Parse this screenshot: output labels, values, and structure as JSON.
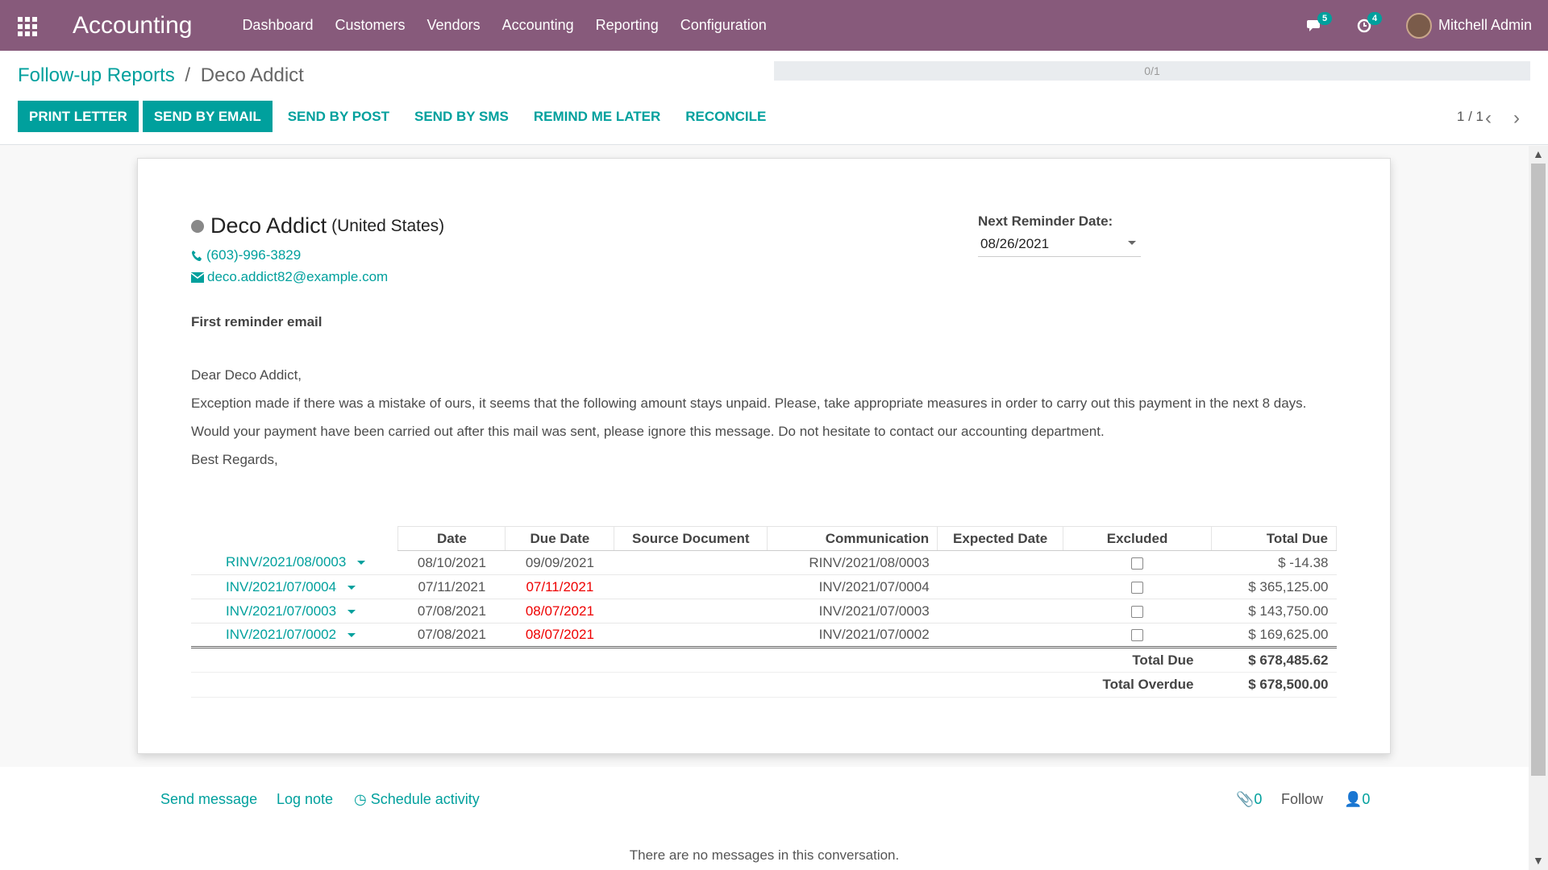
{
  "navbar": {
    "brand": "Accounting",
    "menu": [
      "Dashboard",
      "Customers",
      "Vendors",
      "Accounting",
      "Reporting",
      "Configuration"
    ],
    "messages_count": "5",
    "activities_count": "4",
    "user_name": "Mitchell Admin"
  },
  "control_panel": {
    "breadcrumb_parent": "Follow-up Reports",
    "breadcrumb_sep": "/",
    "breadcrumb_current": "Deco Addict",
    "progress_text": "0/1",
    "progress_value": 0,
    "buttons": {
      "print_letter": "PRINT LETTER",
      "send_by_email": "SEND BY EMAIL",
      "send_by_post": "SEND BY POST",
      "send_by_sms": "SEND BY SMS",
      "remind_me_later": "REMIND ME LATER",
      "reconcile": "RECONCILE"
    },
    "pager": "1 / 1"
  },
  "report": {
    "partner_name": "Deco Addict",
    "partner_country": "(United States)",
    "phone": "(603)-996-3829",
    "email": "deco.addict82@example.com",
    "next_reminder_label": "Next Reminder Date:",
    "next_reminder_date": "08/26/2021",
    "followup_level": "First reminder email",
    "letter": {
      "greeting": "Dear Deco Addict,",
      "para1": "Exception made if there was a mistake of ours, it seems that the following amount stays unpaid. Please, take appropriate measures in order to carry out this payment in the next 8 days.",
      "para2": "Would your payment have been carried out after this mail was sent, please ignore this message. Do not hesitate to contact our accounting department.",
      "closing": "Best Regards,"
    },
    "table": {
      "headers": {
        "date": "Date",
        "due_date": "Due Date",
        "source": "Source Document",
        "communication": "Communication",
        "expected": "Expected Date",
        "excluded": "Excluded",
        "total_due": "Total Due"
      },
      "rows": [
        {
          "ref": "RINV/2021/08/0003",
          "date": "08/10/2021",
          "due": "09/09/2021",
          "source": "",
          "comm": "RINV/2021/08/0003",
          "expected": "",
          "excluded": false,
          "total": "$ -14.38",
          "overdue": false
        },
        {
          "ref": "INV/2021/07/0004",
          "date": "07/11/2021",
          "due": "07/11/2021",
          "source": "",
          "comm": "INV/2021/07/0004",
          "expected": "",
          "excluded": false,
          "total": "$ 365,125.00",
          "overdue": true
        },
        {
          "ref": "INV/2021/07/0003",
          "date": "07/08/2021",
          "due": "08/07/2021",
          "source": "",
          "comm": "INV/2021/07/0003",
          "expected": "",
          "excluded": false,
          "total": "$ 143,750.00",
          "overdue": true
        },
        {
          "ref": "INV/2021/07/0002",
          "date": "07/08/2021",
          "due": "08/07/2021",
          "source": "",
          "comm": "INV/2021/07/0002",
          "expected": "",
          "excluded": false,
          "total": "$ 169,625.00",
          "overdue": true
        }
      ],
      "total_due_label": "Total Due",
      "total_due_value": "$ 678,485.62",
      "total_overdue_label": "Total Overdue",
      "total_overdue_value": "$ 678,500.00"
    }
  },
  "chatter": {
    "send_message": "Send message",
    "log_note": "Log note",
    "schedule_activity": "Schedule activity",
    "attachments_count": "0",
    "follow": "Follow",
    "followers_count": "0",
    "empty_text": "There are no messages in this conversation."
  },
  "colors": {
    "navbar": "#875a7b",
    "accent": "#00a09d",
    "overdue": "#ee0000"
  },
  "icons": [
    "apps-grid-icon",
    "chat-icon",
    "clock-icon",
    "phone-icon",
    "envelope-icon",
    "caret-down-icon",
    "chevron-left-icon",
    "chevron-right-icon",
    "paperclip-icon",
    "user-icon"
  ]
}
